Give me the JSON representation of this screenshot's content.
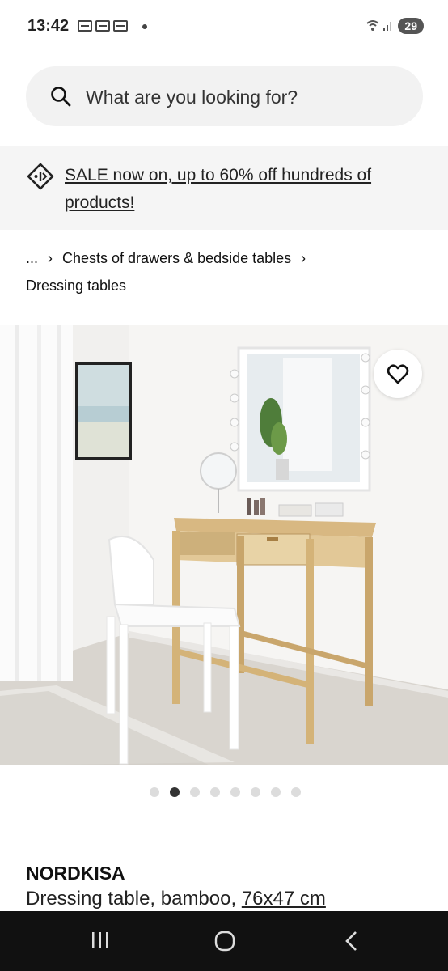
{
  "status_bar": {
    "time": "13:42",
    "battery": "29"
  },
  "search": {
    "placeholder": "What are you looking for?"
  },
  "banner": {
    "text": "SALE now on, up to 60% off hundreds of products!"
  },
  "breadcrumb": {
    "ellipsis": "...",
    "parent": "Chests of drawers & bedside tables",
    "current": "Dressing tables"
  },
  "carousel": {
    "total": 8,
    "active_index": 1
  },
  "product": {
    "name": "NORDKISA",
    "description": "Dressing table, bamboo, ",
    "size": "76x47 cm"
  }
}
